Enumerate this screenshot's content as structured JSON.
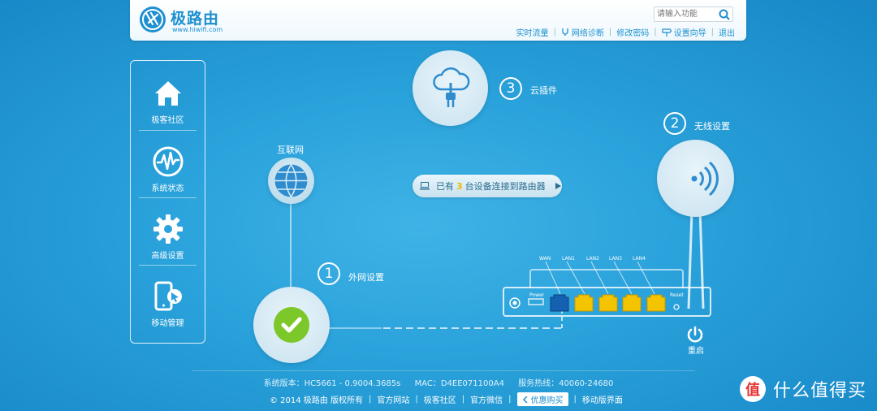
{
  "header": {
    "logo_name": "极路由",
    "logo_url": "www.hiwifi.com",
    "search_placeholder": "请输入功能",
    "links": [
      "实时流量",
      "网络诊断",
      "修改密码",
      "设置向导",
      "退出"
    ]
  },
  "sidebar": {
    "items": [
      {
        "label": "极客社区",
        "icon": "home-icon"
      },
      {
        "label": "系统状态",
        "icon": "pulse-icon"
      },
      {
        "label": "高级设置",
        "icon": "gear-icon"
      },
      {
        "label": "移动管理",
        "icon": "mobile-icon"
      }
    ]
  },
  "main": {
    "internet_label": "互联网",
    "step1": {
      "num": "1",
      "label": "外网设置"
    },
    "step2": {
      "num": "2",
      "label": "无线设置"
    },
    "step3": {
      "num": "3",
      "label": "云插件"
    },
    "devices": {
      "prefix": "已有",
      "count": "3",
      "suffix": "台设备连接到路由器"
    },
    "router": {
      "ports": [
        "WAN",
        "LAN1",
        "LAN2",
        "LAN3",
        "LAN4"
      ],
      "power_label": "Power",
      "reset_label": "Reset",
      "restart_label": "重启"
    }
  },
  "footer": {
    "version": "系统版本：HC5661 - 0.9004.3685s",
    "mac": "MAC：D4EE071100A4",
    "hotline": "服务热线：40060-24680",
    "copyright": "© 2014 极路由 版权所有",
    "links": [
      "官方网站",
      "极客社区",
      "官方微信"
    ],
    "buy": "优惠购买",
    "mobile": "移动版界面"
  },
  "watermark": {
    "text": "什么值得买"
  },
  "colors": {
    "accent": "#1d8fd0",
    "background": "#2aa2db",
    "ok_green": "#7cc72a",
    "port_yellow": "#f5c400",
    "wan_blue": "#1560b0"
  }
}
